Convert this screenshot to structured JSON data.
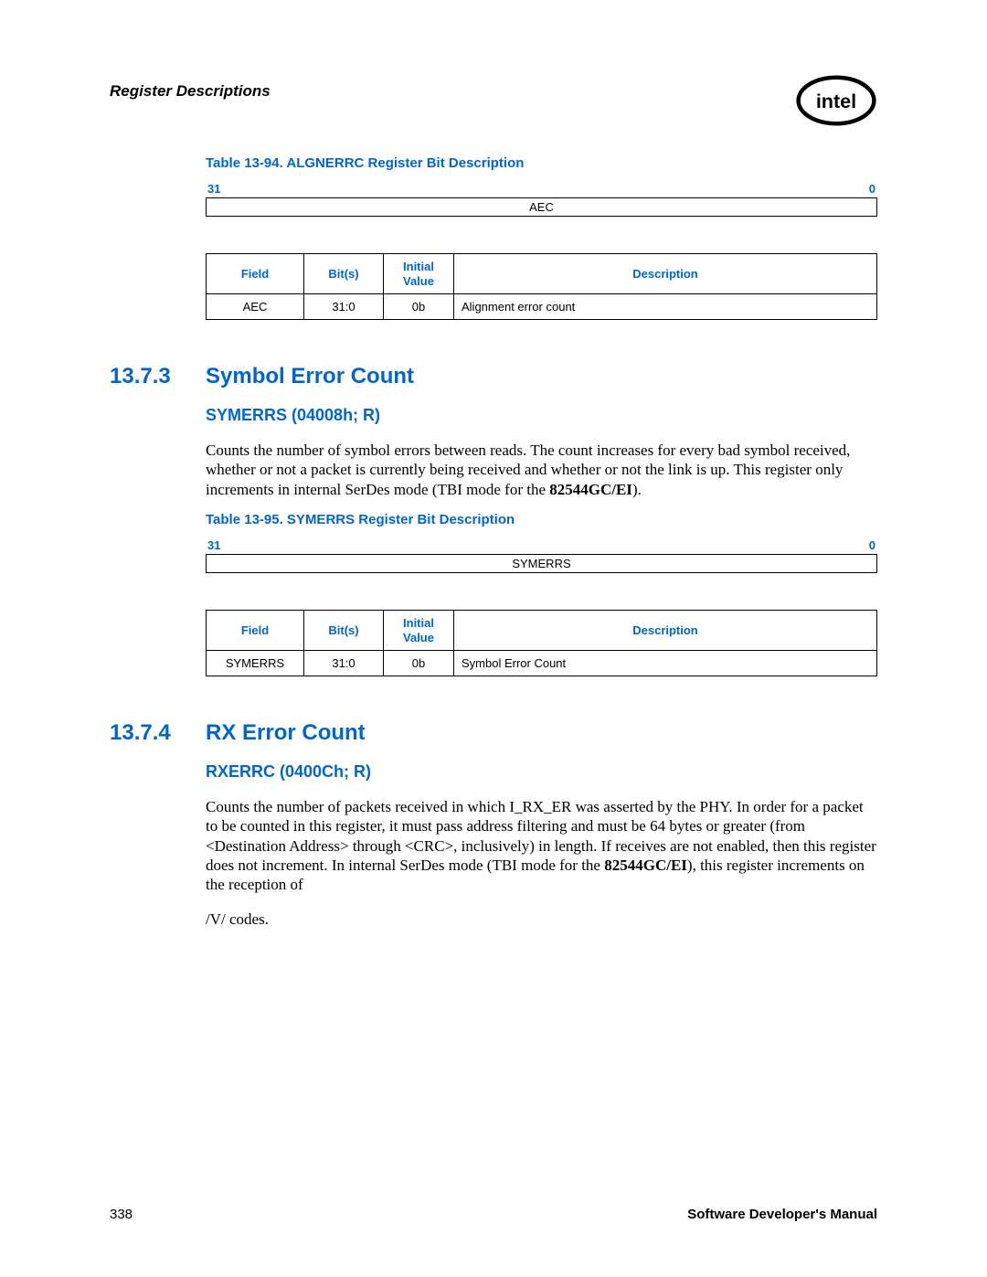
{
  "header": {
    "section_title": "Register Descriptions"
  },
  "table94": {
    "caption": "Table 13-94. ALGNERRC Register Bit Description",
    "bit_high": "31",
    "bit_low": "0",
    "bit_name": "AEC",
    "headers": {
      "field": "Field",
      "bits": "Bit(s)",
      "initial": "Initial Value",
      "desc": "Description"
    },
    "row": {
      "field": "AEC",
      "bits": "31:0",
      "initial": "0b",
      "desc": "Alignment error count"
    }
  },
  "sec1373": {
    "num": "13.7.3",
    "title": "Symbol Error Count",
    "sub": "SYMERRS (04008h; R)",
    "para_a": "Counts the number of symbol errors between reads. The count increases for every bad symbol received, whether or not a packet is currently being received and whether or not the link is up. This register only increments in internal SerDes mode (TBI mode for the ",
    "para_bold": "82544GC/EI",
    "para_b": ")."
  },
  "table95": {
    "caption": "Table 13-95. SYMERRS Register Bit Description",
    "bit_high": "31",
    "bit_low": "0",
    "bit_name": "SYMERRS",
    "headers": {
      "field": "Field",
      "bits": "Bit(s)",
      "initial": "Initial Value",
      "desc": "Description"
    },
    "row": {
      "field": "SYMERRS",
      "bits": "31:0",
      "initial": "0b",
      "desc": "Symbol Error Count"
    }
  },
  "sec1374": {
    "num": "13.7.4",
    "title": "RX Error Count",
    "sub": "RXERRC (0400Ch; R)",
    "para_a": "Counts the number of packets received in which I_RX_ER was asserted by the PHY. In order for a packet to be counted in this register, it must pass address filtering and must be 64 bytes or greater (from <Destination Address> through <CRC>, inclusively) in length. If receives are not enabled, then this register does not increment. In internal SerDes mode (TBI mode for the ",
    "para_bold": "82544GC/EI",
    "para_b": "), this register increments on the reception of",
    "para_c": "/V/ codes."
  },
  "footer": {
    "page": "338",
    "doc": "Software Developer's Manual"
  }
}
